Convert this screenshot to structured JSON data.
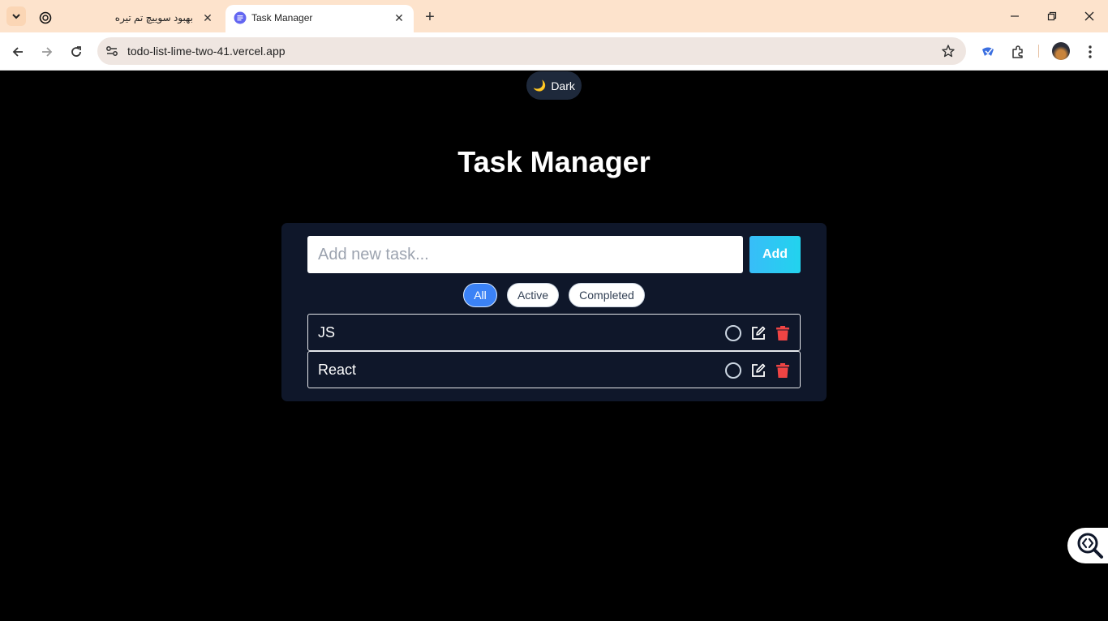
{
  "browser": {
    "tabs": [
      {
        "title": "بهبود سوییچ تم تیره",
        "active": false,
        "favicon": "openai-icon"
      },
      {
        "title": "Task Manager",
        "active": true,
        "favicon": "task-manager-favicon"
      }
    ],
    "url": "todo-list-lime-two-41.vercel.app"
  },
  "theme_toggle": {
    "icon": "moon-emoji",
    "glyph": "🌙",
    "label": "Dark"
  },
  "app": {
    "title": "Task Manager",
    "input": {
      "placeholder": "Add new task...",
      "value": ""
    },
    "add_label": "Add",
    "filters": [
      {
        "label": "All",
        "selected": true
      },
      {
        "label": "Active",
        "selected": false
      },
      {
        "label": "Completed",
        "selected": false
      }
    ],
    "tasks": [
      {
        "text": "JS",
        "completed": false
      },
      {
        "text": "React",
        "completed": false
      }
    ]
  },
  "colors": {
    "accent": "#3b82f6",
    "add_button": "#22d3ee",
    "delete": "#ef4444",
    "card": "#0f172a",
    "page_bg": "#000000",
    "tabbar": "#fde3cc"
  }
}
